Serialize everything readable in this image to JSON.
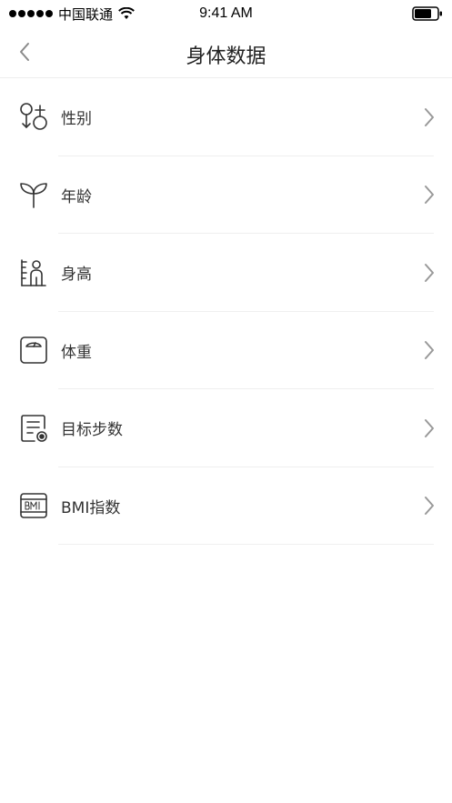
{
  "status_bar": {
    "carrier": "中国联通",
    "time": "9:41 AM"
  },
  "nav": {
    "title": "身体数据",
    "back_icon": "chevron-left-icon"
  },
  "items": [
    {
      "label": "性别",
      "icon": "gender-icon"
    },
    {
      "label": "年龄",
      "icon": "sprout-icon"
    },
    {
      "label": "身高",
      "icon": "height-icon"
    },
    {
      "label": "体重",
      "icon": "scale-icon"
    },
    {
      "label": "目标步数",
      "icon": "goal-steps-icon"
    },
    {
      "label": "BMI指数",
      "icon": "bmi-icon"
    }
  ],
  "colors": {
    "icon_stroke": "#333333",
    "chevron": "#999999",
    "divider": "#efefef"
  }
}
